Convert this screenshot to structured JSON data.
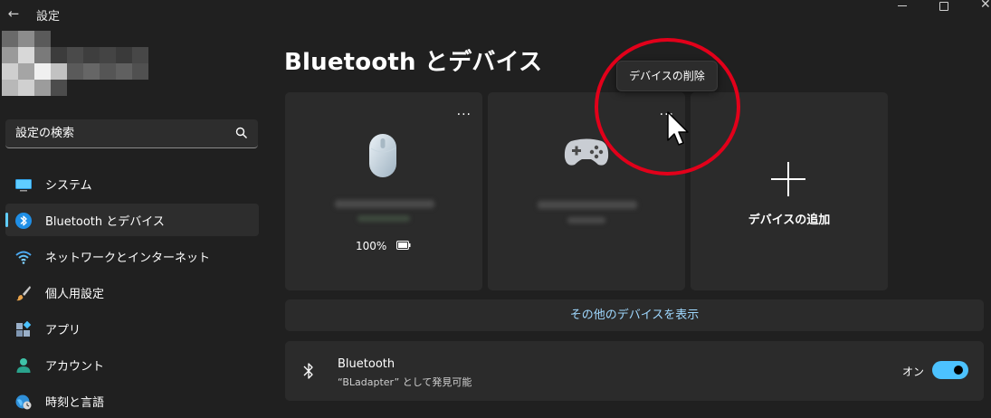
{
  "window": {
    "app_title": "設定"
  },
  "search": {
    "placeholder": "設定の検索"
  },
  "sidebar": {
    "items": [
      {
        "label": "システム",
        "icon": "monitor-icon"
      },
      {
        "label": "Bluetooth とデバイス",
        "icon": "bluetooth-icon",
        "active": true
      },
      {
        "label": "ネットワークとインターネット",
        "icon": "wifi-icon"
      },
      {
        "label": "個人用設定",
        "icon": "brush-icon"
      },
      {
        "label": "アプリ",
        "icon": "apps-icon"
      },
      {
        "label": "アカウント",
        "icon": "person-icon"
      },
      {
        "label": "時刻と言語",
        "icon": "globe-clock-icon"
      }
    ]
  },
  "main": {
    "title": "Bluetooth とデバイス",
    "devices": [
      {
        "icon": "mouse-icon",
        "battery": "100%",
        "more": "..."
      },
      {
        "icon": "gamepad-icon",
        "more": "..."
      }
    ],
    "add_device": {
      "label": "デバイスの追加"
    },
    "tooltip": "デバイスの削除",
    "more_devices": "その他のデバイスを表示",
    "bluetooth": {
      "title": "Bluetooth",
      "subtitle": "“BLadapter” として発見可能",
      "state_label": "オン",
      "enabled": true
    }
  },
  "colors": {
    "accent": "#4cc2ff",
    "link": "#9fd8ff",
    "highlight_ring": "#e2001a"
  }
}
